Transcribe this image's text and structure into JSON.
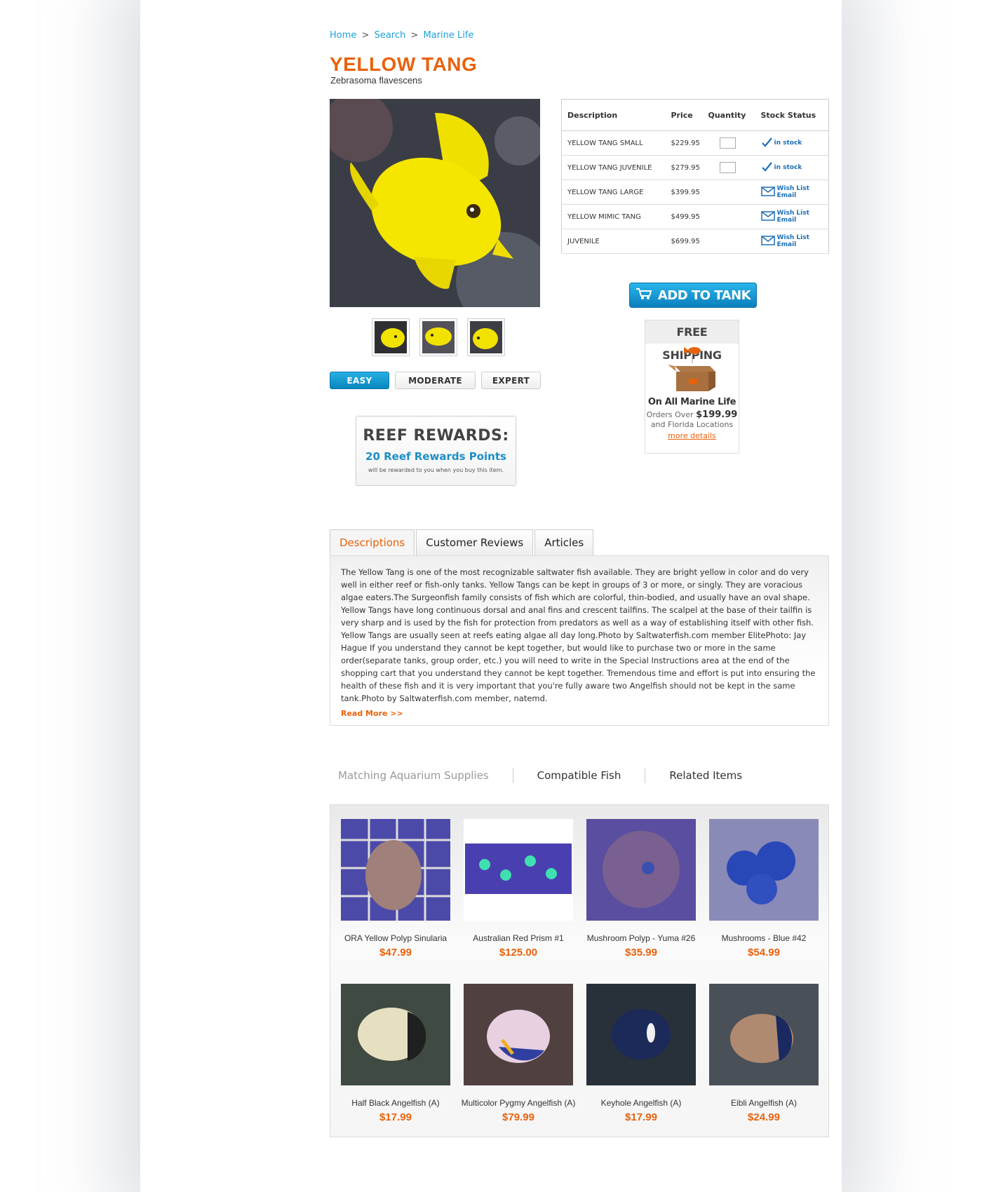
{
  "breadcrumb": {
    "home": "Home",
    "search": "Search",
    "marine": "Marine Life",
    "sep": ">"
  },
  "product": {
    "title": "YELLOW TANG",
    "scientific": "Zebrasoma flavescens"
  },
  "difficulty": {
    "easy": "EASY",
    "moderate": "MODERATE",
    "expert": "EXPERT",
    "selected": "EASY"
  },
  "rewards": {
    "title": "REEF REWARDS:",
    "points": "20 Reef Rewards Points",
    "note": "will be rewarded to you when you buy this item."
  },
  "stock_table": {
    "headers": {
      "description": "Description",
      "price": "Price",
      "quantity": "Quantity",
      "status": "Stock Status"
    },
    "rows": [
      {
        "description": "YELLOW TANG  SMALL",
        "price": "$229.95",
        "status": "in stock"
      },
      {
        "description": "YELLOW TANG  JUVENILE",
        "price": "$279.95",
        "status": "in stock"
      },
      {
        "description": "YELLOW TANG LARGE",
        "price": "$399.95",
        "status": "Wish List Email"
      },
      {
        "description": "YELLOW MIMIC TANG",
        "price": "$499.95",
        "status": "Wish List Email"
      },
      {
        "description": "JUVENILE",
        "price": "$699.95",
        "status": "Wish List Email"
      }
    ]
  },
  "add_to_tank": "ADD TO TANK",
  "free_shipping": {
    "title": "FREE SHIPPING",
    "line1": "On All Marine Life",
    "orders_over": "Orders Over",
    "amount": "$199.99",
    "line3": "and Florida Locations",
    "more": "more details"
  },
  "tabs": {
    "descriptions": "Descriptions",
    "reviews": "Customer Reviews",
    "articles": "Articles"
  },
  "description": {
    "text": "The Yellow Tang is one of the most recognizable saltwater fish available. They are bright yellow in color and do very well in either reef or fish-only tanks. Yellow Tangs can be kept in groups of 3 or more, or singly. They are voracious algae eaters.The Surgeonfish family consists of fish which are colorful, thin-bodied, and usually have an oval shape. Yellow Tangs have long continuous dorsal and anal fins and crescent tailfins. The scalpel at the base of their tailfin is very sharp and is used by the fish for protection from predators as well as a way of establishing itself with other fish. Yellow Tangs are usually seen at reefs eating algae all day long.Photo by Saltwaterfish.com member ElitePhoto: Jay Hague If you understand they cannot be kept together, but would like to purchase two or more in the same order(separate tanks, group order, etc.) you will need to write in the Special Instructions area at the end of the shopping cart that you understand they cannot be kept together. Tremendous time and effort is put into ensuring the health of these fish and it is very important that you're fully aware two Angelfish should not be kept in the same tank.Photo by Saltwaterfish.com member, natemd.",
    "read_more": "Read More >>"
  },
  "related_tabs": {
    "supplies": "Matching Aquarium Supplies",
    "compatible": "Compatible Fish",
    "related": "Related Items"
  },
  "related_items": [
    {
      "name": "ORA Yellow Polyp Sinularia",
      "price": "$47.99"
    },
    {
      "name": "Australian Red Prism #1",
      "price": "$125.00"
    },
    {
      "name": "Mushroom Polyp - Yuma #26",
      "price": "$35.99"
    },
    {
      "name": "Mushrooms - Blue #42",
      "price": "$54.99"
    },
    {
      "name": "Half Black Angelfish (A)",
      "price": "$17.99"
    },
    {
      "name": "Multicolor Pygmy Angelfish (A)",
      "price": "$79.99"
    },
    {
      "name": "Keyhole Angelfish (A)",
      "price": "$17.99"
    },
    {
      "name": "Eibli Angelfish (A)",
      "price": "$24.99"
    }
  ],
  "colors": {
    "accent_orange": "#e8620d",
    "accent_blue": "#1ba3d9",
    "fish_yellow": "#f2e200"
  }
}
